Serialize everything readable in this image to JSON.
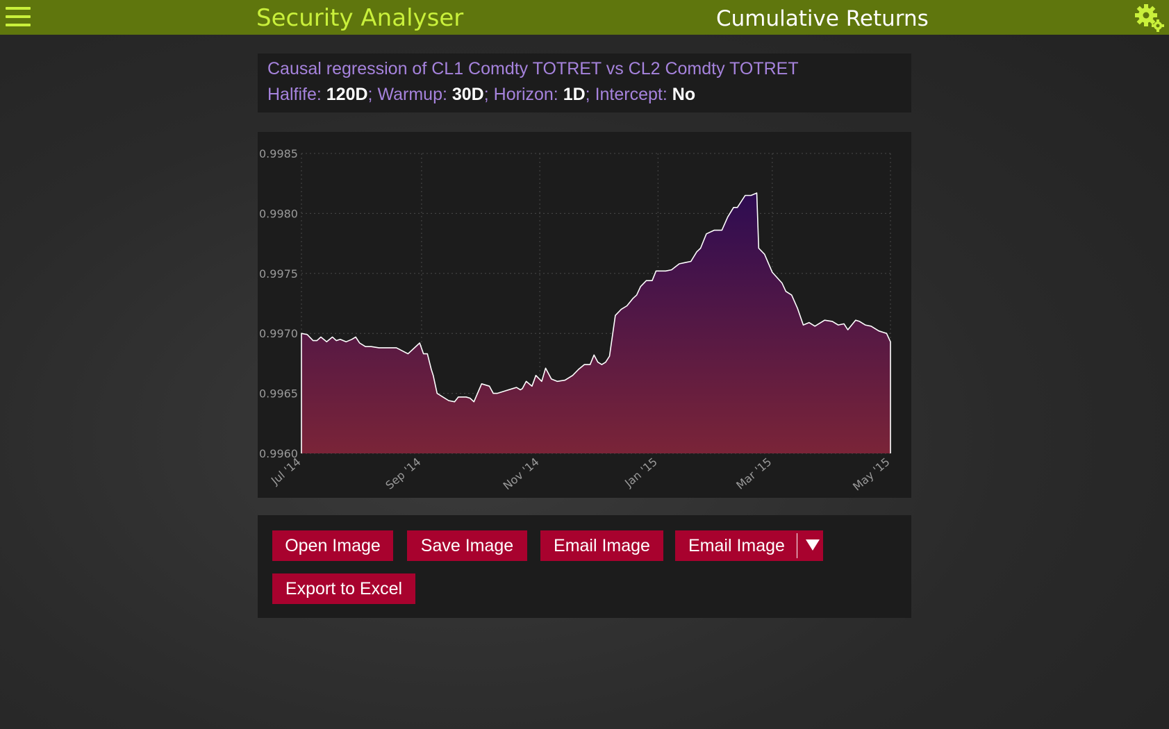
{
  "header": {
    "app_title": "Security Analyser",
    "page_title": "Cumulative Returns"
  },
  "info": {
    "title": "Causal regression of CL1 Comdty TOTRET vs CL2 Comdty TOTRET",
    "params": [
      {
        "label": "Halfife:",
        "value": "120D",
        "sep": ";"
      },
      {
        "label": "Warmup:",
        "value": "30D",
        "sep": ";"
      },
      {
        "label": "Horizon:",
        "value": "1D",
        "sep": ";"
      },
      {
        "label": "Intercept:",
        "value": "No",
        "sep": ""
      }
    ]
  },
  "chart_data": {
    "type": "area",
    "title": "",
    "xlabel": "",
    "ylabel": "",
    "ylim": [
      0.996,
      0.9985
    ],
    "y_ticks": [
      "0.9960",
      "0.9965",
      "0.9970",
      "0.9975",
      "0.9980",
      "0.9985"
    ],
    "x_ticks": [
      "Jul '14",
      "Sep '14",
      "Nov '14",
      "Jan '15",
      "Mar '15",
      "May '15"
    ],
    "grid": true,
    "colors": {
      "line": "#ffffff",
      "fill_top": "#2e0c52",
      "fill_bottom": "#7a2438"
    },
    "series": [
      {
        "x": [
          "2014-07-01",
          "2014-07-04",
          "2014-07-07",
          "2014-07-09",
          "2014-07-11",
          "2014-07-14",
          "2014-07-17",
          "2014-07-19",
          "2014-07-21",
          "2014-07-24",
          "2014-07-27",
          "2014-07-29",
          "2014-07-31",
          "2014-08-03",
          "2014-08-06",
          "2014-08-10",
          "2014-08-14",
          "2014-08-19",
          "2014-08-25",
          "2014-08-31",
          "2014-09-02",
          "2014-09-04",
          "2014-09-06",
          "2014-09-07",
          "2014-09-09",
          "2014-09-12",
          "2014-09-15",
          "2014-09-18",
          "2014-09-20",
          "2014-09-22",
          "2014-09-24",
          "2014-09-26",
          "2014-09-28",
          "2014-10-02",
          "2014-10-06",
          "2014-10-08",
          "2014-10-10",
          "2014-10-14",
          "2014-10-18",
          "2014-10-20",
          "2014-10-22",
          "2014-10-23",
          "2014-10-25",
          "2014-10-28",
          "2014-10-30",
          "2014-11-02",
          "2014-11-04",
          "2014-11-07",
          "2014-11-10",
          "2014-11-14",
          "2014-11-17",
          "2014-11-18",
          "2014-11-21",
          "2014-11-24",
          "2014-11-27",
          "2014-11-29",
          "2014-12-01",
          "2014-12-03",
          "2014-12-05",
          "2014-12-07",
          "2014-12-10",
          "2014-12-13",
          "2014-12-16",
          "2014-12-19",
          "2014-12-21",
          "2014-12-23",
          "2014-12-26",
          "2014-12-29",
          "2014-12-31",
          "2015-01-02",
          "2015-01-05",
          "2015-01-08",
          "2015-01-12",
          "2015-01-15",
          "2015-01-18",
          "2015-01-21",
          "2015-01-23",
          "2015-01-26",
          "2015-01-30",
          "2015-02-03",
          "2015-02-06",
          "2015-02-09",
          "2015-02-11",
          "2015-02-15",
          "2015-02-18",
          "2015-02-21",
          "2015-02-22",
          "2015-02-25",
          "2015-03-01",
          "2015-03-06",
          "2015-03-08",
          "2015-03-11",
          "2015-03-14",
          "2015-03-17",
          "2015-03-20",
          "2015-03-23",
          "2015-03-28",
          "2015-04-01",
          "2015-04-04",
          "2015-04-07",
          "2015-04-09",
          "2015-04-11",
          "2015-04-13",
          "2015-04-15",
          "2015-04-18",
          "2015-04-21",
          "2015-04-25",
          "2015-04-29",
          "2015-05-01"
        ],
        "values": [
          0.997,
          0.99699,
          0.99694,
          0.99694,
          0.99697,
          0.99693,
          0.99697,
          0.99694,
          0.99695,
          0.99693,
          0.99695,
          0.99697,
          0.99692,
          0.99689,
          0.99689,
          0.99688,
          0.99688,
          0.99688,
          0.99683,
          0.99692,
          0.99683,
          0.99683,
          0.9967,
          0.99665,
          0.9965,
          0.99647,
          0.99644,
          0.99643,
          0.99647,
          0.99647,
          0.99647,
          0.99646,
          0.99643,
          0.99658,
          0.99656,
          0.9965,
          0.9965,
          0.99652,
          0.99654,
          0.99655,
          0.99653,
          0.99654,
          0.9966,
          0.99656,
          0.99665,
          0.9966,
          0.99671,
          0.99662,
          0.9966,
          0.99661,
          0.99664,
          0.99665,
          0.9967,
          0.99674,
          0.99674,
          0.99682,
          0.99676,
          0.99674,
          0.99676,
          0.99681,
          0.99715,
          0.9972,
          0.99723,
          0.99729,
          0.99732,
          0.99739,
          0.99744,
          0.99744,
          0.99752,
          0.99752,
          0.99752,
          0.99753,
          0.99758,
          0.99759,
          0.9976,
          0.99768,
          0.99771,
          0.99783,
          0.99786,
          0.99786,
          0.99797,
          0.99805,
          0.99805,
          0.99815,
          0.99815,
          0.99817,
          0.99771,
          0.99766,
          0.99751,
          0.99742,
          0.99735,
          0.99732,
          0.99721,
          0.99707,
          0.99709,
          0.99706,
          0.99711,
          0.9971,
          0.99707,
          0.99708,
          0.99703,
          0.99707,
          0.99711,
          0.9971,
          0.99707,
          0.99706,
          0.99702,
          0.997,
          0.99693
        ]
      }
    ]
  },
  "buttons": {
    "open": "Open Image",
    "save": "Save Image",
    "email": "Email Image",
    "email_menu": "Email Image",
    "export": "Export to Excel"
  }
}
